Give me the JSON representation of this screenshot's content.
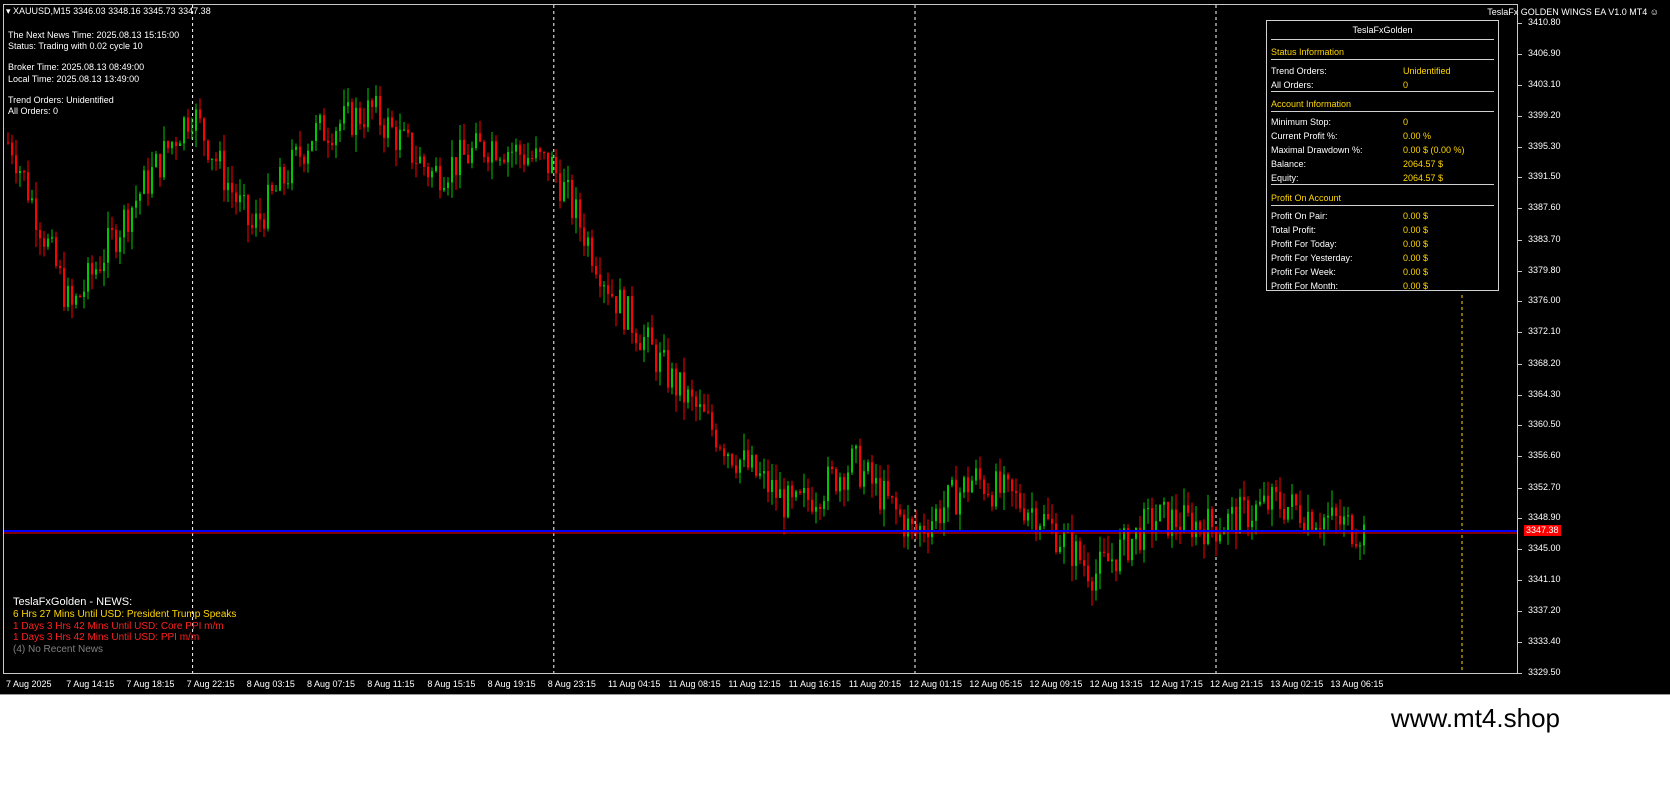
{
  "symbol_bar": {
    "icon": "triangle-down-icon",
    "text": "XAUUSD,M15  3346.03 3348.16 3345.73 3347.38"
  },
  "ea_title": "TeslaFx GOLDEN WINGS EA  V1.0 MT4",
  "ea_icon": "smiley-icon",
  "info": {
    "news_time": "The Next News Time: 2025.08.13 15:15:00",
    "status": "Status: Trading with 0.02 cycle 10",
    "broker_time": "Broker Time: 2025.08.13 08:49:00",
    "local_time": "Local Time: 2025.08.13 13:49:00",
    "trend_orders": "Trend Orders: Unidentified",
    "all_orders": "All Orders: 0"
  },
  "panel": {
    "title": "TeslaFxGolden",
    "status_header": "Status Information",
    "status_rows": [
      {
        "label": "Trend Orders:",
        "value": "Unidentified"
      },
      {
        "label": "All Orders:",
        "value": "0"
      }
    ],
    "account_header": "Account Information",
    "account_rows": [
      {
        "label": "Minimum Stop:",
        "value": "0"
      },
      {
        "label": "Current Profit %:",
        "value": "0.00 %"
      },
      {
        "label": "Maximal Drawdown %:",
        "value": "0.00 $ (0.00 %)"
      },
      {
        "label": "Balance:",
        "value": "2064.57 $"
      },
      {
        "label": "Equity:",
        "value": "2064.57 $"
      }
    ],
    "profit_header": "Profit On Account",
    "profit_rows": [
      {
        "label": "Profit On Pair:",
        "value": "0.00 $"
      },
      {
        "label": "Total Profit:",
        "value": "0.00 $"
      },
      {
        "label": "Profit For Today:",
        "value": "0.00 $"
      },
      {
        "label": "Profit For Yesterday:",
        "value": "0.00 $"
      },
      {
        "label": "Profit For Week:",
        "value": "0.00 $"
      },
      {
        "label": "Profit For Month:",
        "value": "0.00 $"
      }
    ]
  },
  "news": {
    "title": "TeslaFxGolden - NEWS:",
    "item1": "6 Hrs 27 Mins Until USD: President Trump Speaks",
    "item2": "1 Days 3 Hrs 42 Mins Until USD: Core PPI m/m",
    "item3": "1 Days 3 Hrs 42 Mins Until USD: PPI m/m",
    "item4": "(4)  No Recent News"
  },
  "price_axis": [
    "3410.80",
    "3406.90",
    "3403.10",
    "3399.20",
    "3395.30",
    "3391.50",
    "3387.60",
    "3383.70",
    "3379.80",
    "3376.00",
    "3372.10",
    "3368.20",
    "3364.30",
    "3360.50",
    "3356.60",
    "3352.70",
    "3348.90",
    "3345.00",
    "3341.10",
    "3337.20",
    "3333.40",
    "3329.50"
  ],
  "current_price": "3347.38",
  "time_axis": [
    "7 Aug 2025",
    "7 Aug 14:15",
    "7 Aug 18:15",
    "7 Aug 22:15",
    "8 Aug 03:15",
    "8 Aug 07:15",
    "8 Aug 11:15",
    "8 Aug 15:15",
    "8 Aug 19:15",
    "8 Aug 23:15",
    "11 Aug 04:15",
    "11 Aug 08:15",
    "11 Aug 12:15",
    "11 Aug 16:15",
    "11 Aug 20:15",
    "12 Aug 01:15",
    "12 Aug 05:15",
    "12 Aug 09:15",
    "12 Aug 13:15",
    "12 Aug 17:15",
    "12 Aug 21:15",
    "13 Aug 02:15",
    "13 Aug 06:15"
  ],
  "colors": {
    "bull": "#00c800",
    "bear": "#ff0000",
    "price_line": "#0000ff",
    "accent": "#ffd700"
  },
  "watermark": "www.mt4.shop",
  "chart_data": {
    "type": "candlestick",
    "ylim": [
      3329.5,
      3410.8
    ],
    "close_path": [
      [
        "7 Aug 2025",
        3396
      ],
      [
        "7 Aug 14:15",
        3375
      ],
      [
        "7 Aug 18:15",
        3388
      ],
      [
        "7 Aug 22:15",
        3400
      ],
      [
        "8 Aug 03:15",
        3385
      ],
      [
        "8 Aug 07:15",
        3397
      ],
      [
        "8 Aug 11:15",
        3400
      ],
      [
        "8 Aug 15:15",
        3392
      ],
      [
        "8 Aug 19:15",
        3396
      ],
      [
        "8 Aug 23:15",
        3393
      ],
      [
        "11 Aug 04:15",
        3377
      ],
      [
        "11 Aug 08:15",
        3366
      ],
      [
        "11 Aug 12:15",
        3357
      ],
      [
        "11 Aug 16:15",
        3350
      ],
      [
        "11 Aug 20:15",
        3356
      ],
      [
        "12 Aug 01:15",
        3347
      ],
      [
        "12 Aug 05:15",
        3354
      ],
      [
        "12 Aug 09:15",
        3350
      ],
      [
        "12 Aug 13:15",
        3342
      ],
      [
        "12 Aug 17:15",
        3349
      ],
      [
        "12 Aug 21:15",
        3348
      ],
      [
        "13 Aug 02:15",
        3351
      ],
      [
        "13 Aug 06:15",
        3347.38
      ]
    ],
    "session_separators": [
      "7 Aug 22:15",
      "8 Aug 23:15",
      "12 Aug 01:15",
      "12 Aug 21:15"
    ],
    "levels": [
      3347.38
    ]
  }
}
